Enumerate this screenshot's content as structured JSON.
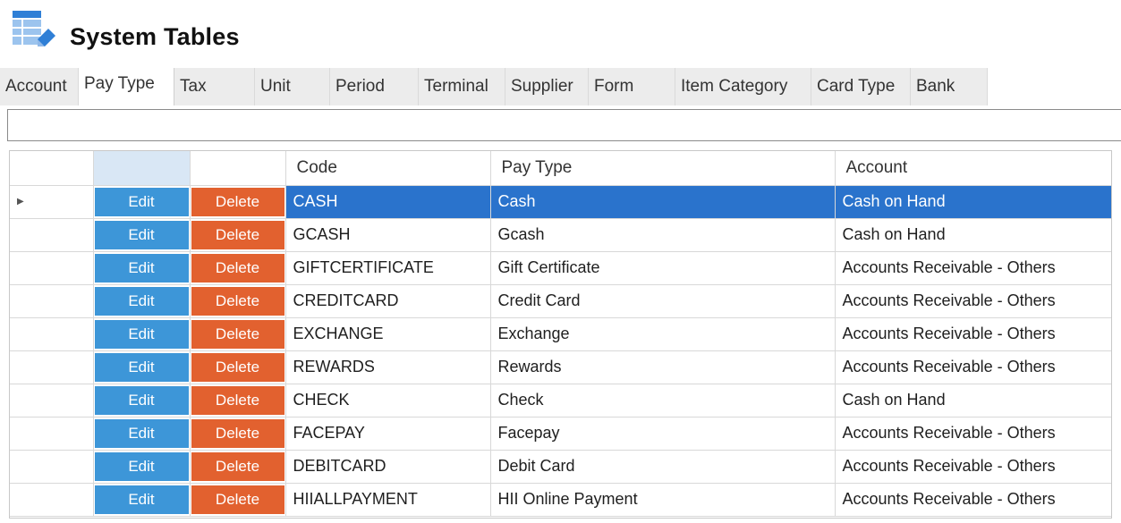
{
  "header": {
    "title": "System Tables",
    "icon": "table-edit-icon"
  },
  "tabs": [
    {
      "label": "Account",
      "active": false
    },
    {
      "label": "Pay Type",
      "active": true
    },
    {
      "label": "Tax",
      "active": false
    },
    {
      "label": "Unit",
      "active": false
    },
    {
      "label": "Period",
      "active": false
    },
    {
      "label": "Terminal",
      "active": false
    },
    {
      "label": "Supplier",
      "active": false
    },
    {
      "label": "Form",
      "active": false
    },
    {
      "label": "Item Category",
      "active": false
    },
    {
      "label": "Card Type",
      "active": false
    },
    {
      "label": "Bank",
      "active": false
    }
  ],
  "search": {
    "value": "",
    "placeholder": ""
  },
  "grid": {
    "columns": [
      "",
      "",
      "",
      "Code",
      "Pay Type",
      "Account"
    ],
    "edit_label": "Edit",
    "delete_label": "Delete",
    "selected_row": 0,
    "rows": [
      {
        "code": "CASH",
        "pay_type": "Cash",
        "account": "Cash on Hand"
      },
      {
        "code": "GCASH",
        "pay_type": "Gcash",
        "account": "Cash on Hand"
      },
      {
        "code": "GIFTCERTIFICATE",
        "pay_type": "Gift Certificate",
        "account": "Accounts Receivable - Others"
      },
      {
        "code": "CREDITCARD",
        "pay_type": "Credit Card",
        "account": "Accounts Receivable - Others"
      },
      {
        "code": "EXCHANGE",
        "pay_type": "Exchange",
        "account": "Accounts Receivable - Others"
      },
      {
        "code": "REWARDS",
        "pay_type": "Rewards",
        "account": "Accounts Receivable - Others"
      },
      {
        "code": "CHECK",
        "pay_type": "Check",
        "account": "Cash on Hand"
      },
      {
        "code": "FACEPAY",
        "pay_type": "Facepay",
        "account": "Accounts Receivable - Others"
      },
      {
        "code": "DEBITCARD",
        "pay_type": "Debit Card",
        "account": "Accounts Receivable - Others"
      },
      {
        "code": "HIIALLPAYMENT",
        "pay_type": "HII Online Payment",
        "account": "Accounts Receivable - Others"
      }
    ]
  },
  "colors": {
    "edit": "#3d96d8",
    "delete": "#e2612f",
    "selection": "#2a73cc",
    "header_selected": "#d9e7f5"
  }
}
